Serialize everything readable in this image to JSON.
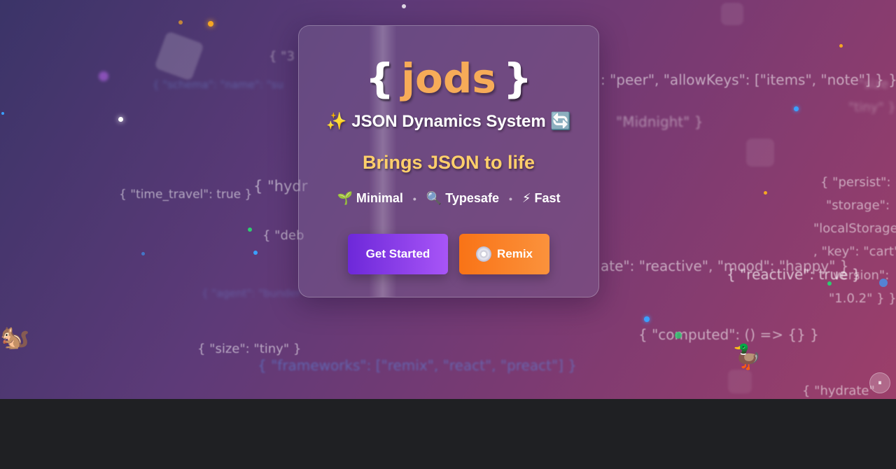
{
  "background_texts": {
    "t1": "{ \"schema\": \"name\": \"su",
    "t2": "{ \"3",
    "t3": ": \"peer\", \"allowKeys\": [\"items\", \"note\"] } }",
    "t4": "\"size",
    "t5": "\"tiny\" }",
    "t6": "\"Midnight\" }",
    "t7": "{ \"time_travel\": true }",
    "t8": "{ \"hydr",
    "t9": "{ \"deb",
    "t10": "{ \"persist\": {",
    "t11": "\"storage\":",
    "t12": "\"localStorage",
    "t13": ", \"key\": \"cart\"",
    "t14": "ate\": \"reactive\", \"mood\": \"happy\" }",
    "t15": "{ \"reactive\": true }",
    "t16": "version\":",
    "t17": "\"1.0.2\" } }",
    "t18": "{ \"agent\": \"bunder",
    "t19": "{ \"computed\": () => {} }",
    "t20": "{ \"size\": \"tiny\" }",
    "t21": "{ \"frameworks\": [\"remix\", \"react\", \"preact\"] }",
    "t22": "{ \"hydrate\""
  },
  "card": {
    "logo_open": "{",
    "logo_word": "jods",
    "logo_close": "}",
    "subtitle_prefix": "✨",
    "subtitle": "JSON Dynamics System",
    "subtitle_suffix": "🔄",
    "tagline": "Brings JSON to life",
    "features": [
      {
        "icon": "🌱",
        "label": "Minimal"
      },
      {
        "icon": "🔍",
        "label": "Typesafe"
      },
      {
        "icon": "⚡",
        "label": "Fast"
      }
    ],
    "separator": "•",
    "get_started_label": "Get Started",
    "remix_label": "Remix"
  },
  "critters": {
    "squirrel": "🐿️",
    "duck": "🦆"
  },
  "pause_label": "⏸",
  "colors": {
    "accent_orange": "#f6ab58",
    "tagline_yellow": "#ffcf6b",
    "button_purple": "#8b3fe6",
    "button_orange": "#f97316"
  }
}
